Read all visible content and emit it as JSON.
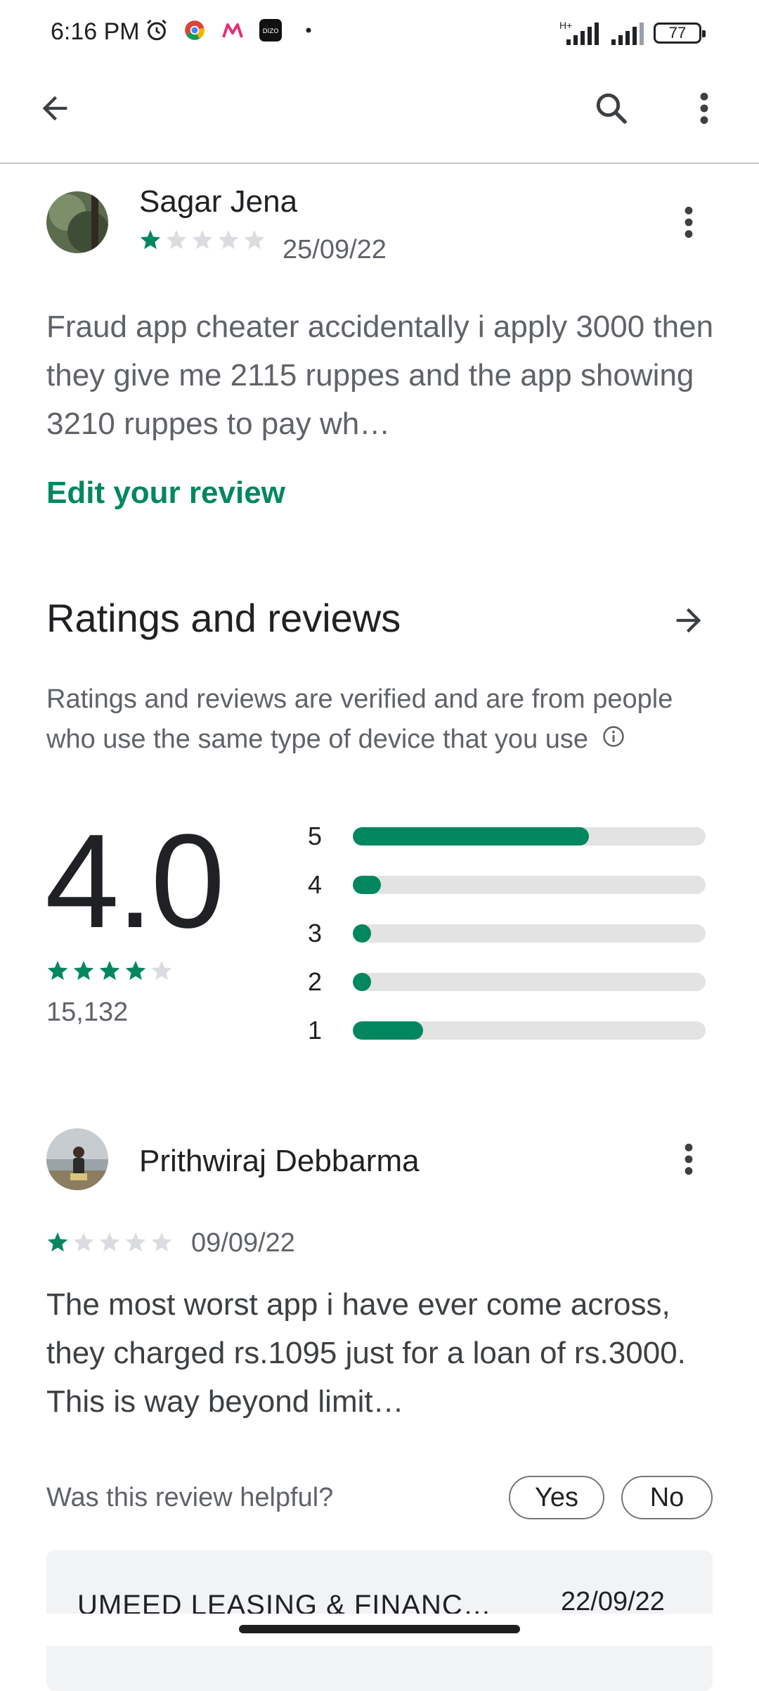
{
  "status_bar": {
    "time": "6:16 PM",
    "battery": "77",
    "network": "H+"
  },
  "colors": {
    "accent": "#01875f",
    "track": "#e3e3e3",
    "text_secondary": "#5f6368"
  },
  "user_review": {
    "name": "Sagar Jena",
    "rating": 1,
    "date": "25/09/22",
    "text": "Fraud app cheater accidentally i apply 3000 then they give me 2115 ruppes and the app showing 3210 ruppes to pay wh…",
    "edit_label": "Edit your review"
  },
  "ratings": {
    "title": "Ratings and reviews",
    "note": "Ratings and reviews are verified and are from people who use the same type of device that you use",
    "average": "4.0",
    "stars": 4,
    "count": "15,132",
    "distribution": [
      {
        "label": "5",
        "fraction": 0.67
      },
      {
        "label": "4",
        "fraction": 0.08
      },
      {
        "label": "3",
        "fraction": 0.05
      },
      {
        "label": "2",
        "fraction": 0.05
      },
      {
        "label": "1",
        "fraction": 0.2
      }
    ]
  },
  "review": {
    "name": "Prithwiraj Debbarma",
    "rating": 1,
    "date": "09/09/22",
    "text": "The most worst app i have ever come across, they charged rs.1095 just for a loan of rs.3000. This is way beyond limit…",
    "helpful_question": "Was this review helpful?",
    "yes_label": "Yes",
    "no_label": "No"
  },
  "developer_reply": {
    "name": "UMEED LEASING & FINANC…",
    "date": "22/09/22"
  }
}
